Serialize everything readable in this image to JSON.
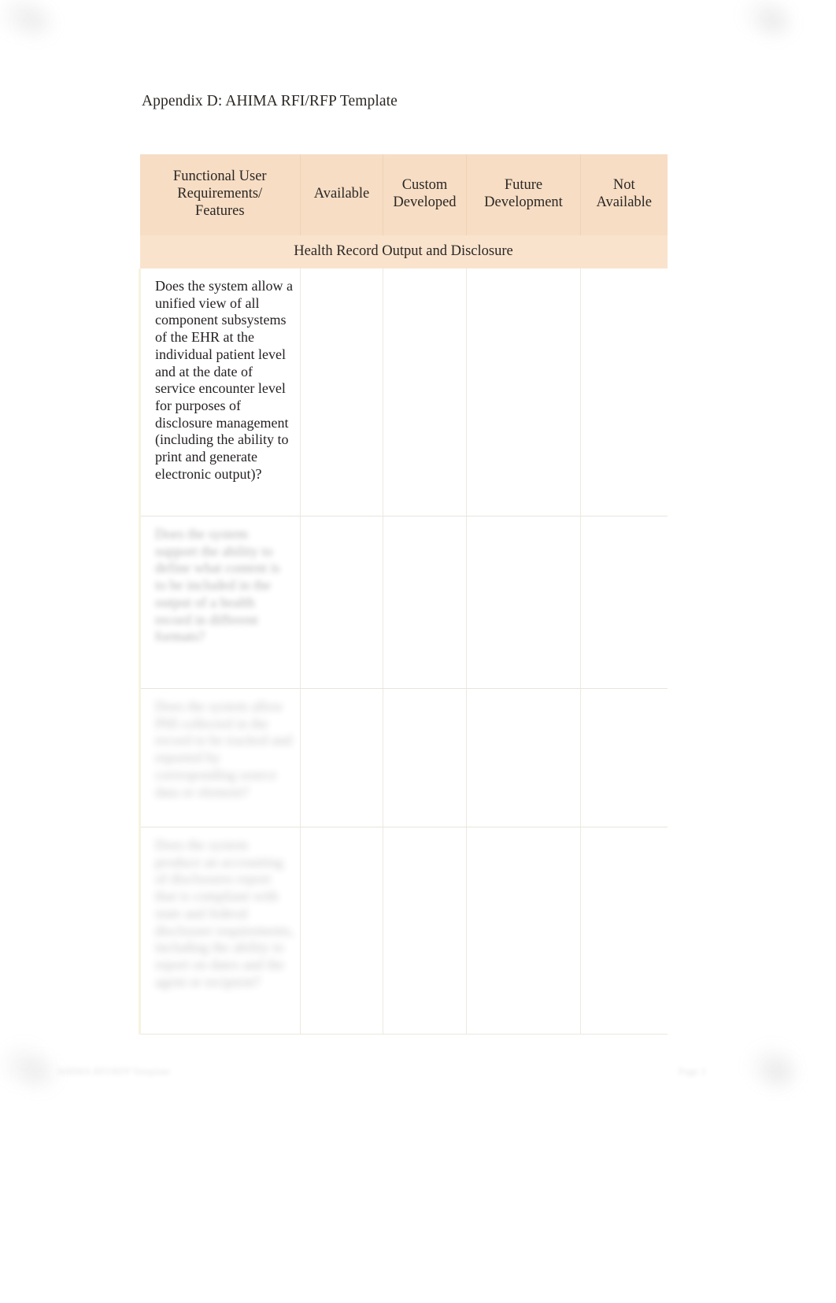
{
  "document": {
    "title": "Appendix D: AHIMA RFI/RFP Template"
  },
  "colors": {
    "header_background": "#f6ddc4",
    "section_background": "#f9e3cd",
    "page_background": "#ffffff",
    "text": "#231f20",
    "cell_border": "#ece9e0",
    "left_accent_border": "#f7f3e0"
  },
  "table": {
    "columns": [
      {
        "key": "requirements",
        "label": "Functional User Requirements/ Features"
      },
      {
        "key": "available",
        "label": "Available"
      },
      {
        "key": "custom_developed",
        "label": "Custom Developed"
      },
      {
        "key": "future_development",
        "label": "Future Development"
      },
      {
        "key": "not_available",
        "label": "Not Available"
      }
    ],
    "section_heading": "Health Record Output and Disclosure",
    "rows": [
      {
        "id": "row-1",
        "legible": true,
        "requirement": "Does the system allow a unified view of all component subsystems of the EHR at the individual patient level and at the date of service encounter level for purposes of disclosure management (including the ability to print and generate electronic output)?",
        "available": "",
        "custom_developed": "",
        "future_development": "",
        "not_available": ""
      },
      {
        "id": "row-2",
        "legible": false,
        "requirement": "Does the system support the ability to define what content is to be included in the output of a health record in different formats?",
        "available": "",
        "custom_developed": "",
        "future_development": "",
        "not_available": ""
      },
      {
        "id": "row-3",
        "legible": false,
        "requirement": "Does the system allow PHI collected in the record to be tracked and reported by corresponding source data or element?",
        "available": "",
        "custom_developed": "",
        "future_development": "",
        "not_available": ""
      },
      {
        "id": "row-4",
        "legible": false,
        "requirement": "Does the system produce an accounting of disclosures report that is compliant with state and federal disclosure requirements, including the ability to report on dates and the agent or recipient?",
        "available": "",
        "custom_developed": "",
        "future_development": "",
        "not_available": ""
      }
    ]
  },
  "footer": {
    "left": "AHIMA RFI/RFP Template",
    "right": "Page 1"
  }
}
